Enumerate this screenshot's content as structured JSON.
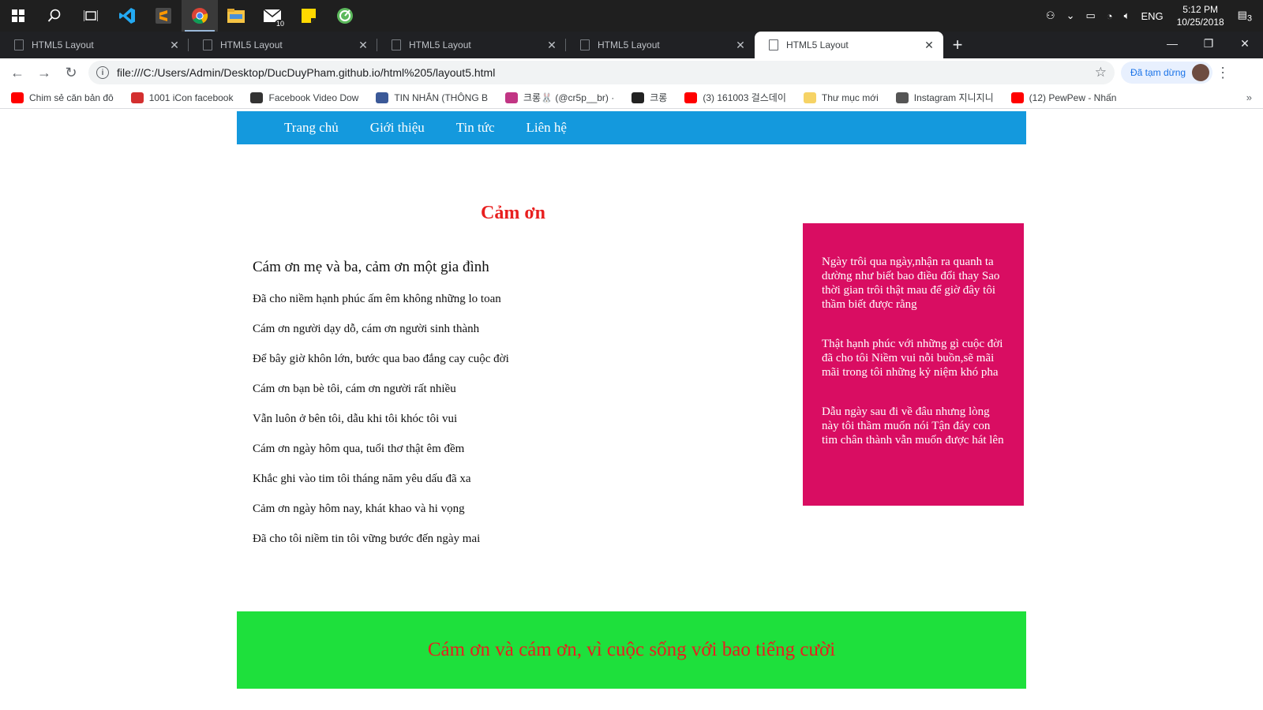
{
  "taskbar": {
    "mail_badge": "10",
    "tray": {
      "lang": "ENG",
      "time": "5:12 PM",
      "date": "10/25/2018",
      "notif_count": "3"
    }
  },
  "browser": {
    "tabs": [
      {
        "label": "HTML5 Layout",
        "active": false
      },
      {
        "label": "HTML5 Layout",
        "active": false
      },
      {
        "label": "HTML5 Layout",
        "active": false
      },
      {
        "label": "HTML5 Layout",
        "active": false
      },
      {
        "label": "HTML5 Layout",
        "active": true
      }
    ],
    "url": "file:///C:/Users/Admin/Desktop/DucDuyPham.github.io/html%205/layout5.html",
    "profile_label": "Đã tạm dừng",
    "bookmarks": [
      {
        "label": "Chim sẻ căn bản đô",
        "icon": "youtube-icon",
        "color": "#ff0000"
      },
      {
        "label": "1001 iCon facebook",
        "icon": "v-logo-icon",
        "color": "#d32f2f"
      },
      {
        "label": "Facebook Video Dow",
        "icon": "facebook-icon",
        "color": "#333333"
      },
      {
        "label": "TIN NHẮN (THÔNG B",
        "icon": "facebook-icon",
        "color": "#3b5998"
      },
      {
        "label": "크롱🐰 (@cr5p__br) ·",
        "icon": "instagram-icon",
        "color": "#c13584"
      },
      {
        "label": "크롱",
        "icon": "crsp-icon",
        "color": "#222222"
      },
      {
        "label": "(3) 161003 걸스데이",
        "icon": "youtube-icon",
        "color": "#ff0000"
      },
      {
        "label": "Thư mục mới",
        "icon": "folder-icon",
        "color": "#f6d365"
      },
      {
        "label": "Instagram 지니지니",
        "icon": "zigzag-icon",
        "color": "#555555"
      },
      {
        "label": "(12) PewPew - Nhấn",
        "icon": "youtube-icon",
        "color": "#ff0000"
      }
    ]
  },
  "page": {
    "nav": [
      "Trang chủ",
      "Giới thiệu",
      "Tin tức",
      "Liên hệ"
    ],
    "main": {
      "title": "Cảm ơn",
      "subtitle": "Cám ơn mẹ và ba, cảm ơn một gia đình",
      "lines": [
        "Đã cho niềm hạnh phúc ấm êm không những lo toan",
        "Cám ơn người dạy dỗ, cám ơn người sinh thành",
        "Để bây giờ khôn lớn, bước qua bao đắng cay cuộc đời",
        "Cám ơn bạn bè tôi, cám ơn người rất nhiều",
        "Vẫn luôn ở bên tôi, dẫu khi tôi khóc tôi vui",
        "Cám ơn ngày hôm qua, tuổi thơ thật êm đềm",
        "Khắc ghi vào tim tôi tháng năm yêu dấu đã xa",
        "Cảm ơn ngày hôm nay, khát khao và hi vọng",
        "Đã cho tôi niềm tin tôi vững bước đến ngày mai"
      ]
    },
    "aside": [
      "Ngày trôi qua ngày,nhận ra quanh ta dường như biết bao điều đổi thay Sao thời gian trôi thật mau để giờ đây tôi thầm biết được rằng",
      "Thật hạnh phúc với những gì cuộc đời đã cho tôi Niềm vui nỗi buồn,sẽ mãi mãi trong tôi những kỷ niệm khó pha",
      "Dẫu ngày sau đi về đâu nhưng lòng này tôi thầm muốn nói Tận đáy con tim chân thành vẫn muốn được hát lên"
    ],
    "footer": "Cám ơn và cám ơn, vì cuộc sống với bao tiếng cười"
  },
  "colors": {
    "nav": "#1499dd",
    "aside": "#d90d62",
    "footer": "#1ee03c",
    "title": "#e81f1f"
  }
}
